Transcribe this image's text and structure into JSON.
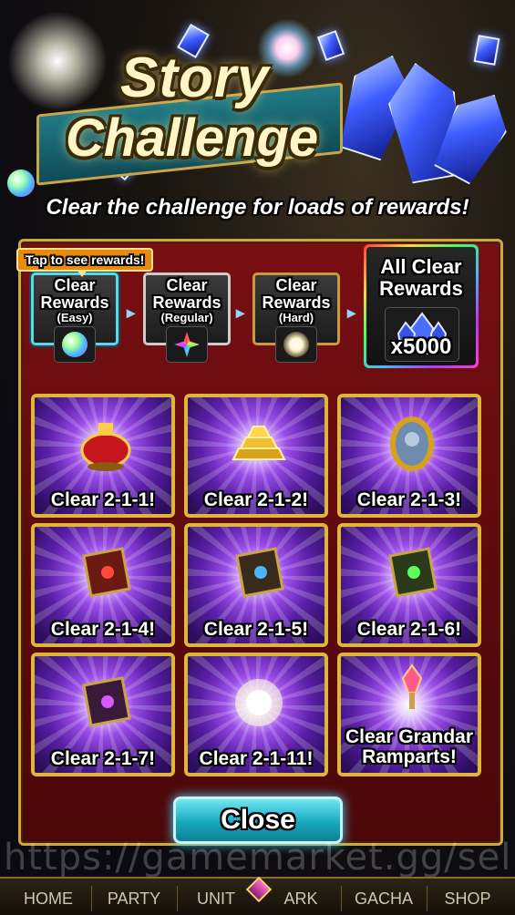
{
  "banner": {
    "title_line1": "Story",
    "title_line2": "Challenge",
    "subtitle": "Clear the challenge for loads of rewards!"
  },
  "tooltip": "Tap to see rewards!",
  "tiers": [
    {
      "label": "Clear\nRewards",
      "difficulty": "(Easy)",
      "icon": "rainbow-orb-icon",
      "selected": true
    },
    {
      "label": "Clear\nRewards",
      "difficulty": "(Regular)",
      "icon": "prism-shard-icon",
      "selected": false
    },
    {
      "label": "Clear\nRewards",
      "difficulty": "(Hard)",
      "icon": "white-burst-icon",
      "selected": false
    }
  ],
  "tier_labels": {
    "line1": "Clear",
    "line2": "Rewards",
    "easy": "(Easy)",
    "regular": "(Regular)",
    "hard": "(Hard)"
  },
  "all_clear": {
    "line1": "All Clear",
    "line2": "Rewards",
    "quantity": "x5000",
    "icon": "blue-crystals-icon"
  },
  "rewards": [
    {
      "label": "Clear 2-1-1!",
      "icon": "red-lantern-icon"
    },
    {
      "label": "Clear 2-1-2!",
      "icon": "gold-bars-icon"
    },
    {
      "label": "Clear 2-1-3!",
      "icon": "crystal-mirror-icon"
    },
    {
      "label": "Clear 2-1-4!",
      "icon": "red-tome-icon"
    },
    {
      "label": "Clear 2-1-5!",
      "icon": "blue-tome-icon"
    },
    {
      "label": "Clear 2-1-6!",
      "icon": "green-tome-icon"
    },
    {
      "label": "Clear 2-1-7!",
      "icon": "purple-tome-icon"
    },
    {
      "label": "Clear 2-1-11!",
      "icon": "light-orb-icon"
    },
    {
      "label": "Clear Grandar\nRamparts!",
      "icon": "crystal-key-icon"
    }
  ],
  "reward_labels": {
    "r0": "Clear 2-1-1!",
    "r1": "Clear 2-1-2!",
    "r2": "Clear 2-1-3!",
    "r3": "Clear 2-1-4!",
    "r4": "Clear 2-1-5!",
    "r5": "Clear 2-1-6!",
    "r6": "Clear 2-1-7!",
    "r7": "Clear 2-1-11!",
    "r8a": "Clear Grandar",
    "r8b": "Ramparts!"
  },
  "close_button": "Close",
  "watermark": "https://gamemarket.gg/seller/",
  "nav": [
    "HOME",
    "PARTY",
    "UNIT",
    "ARK",
    "GACHA",
    "SHOP"
  ],
  "colors": {
    "panel": "#6b0c10",
    "gold_border": "#e0b637",
    "close_button": "#18a9bf",
    "tooltip": "#e98a10"
  }
}
